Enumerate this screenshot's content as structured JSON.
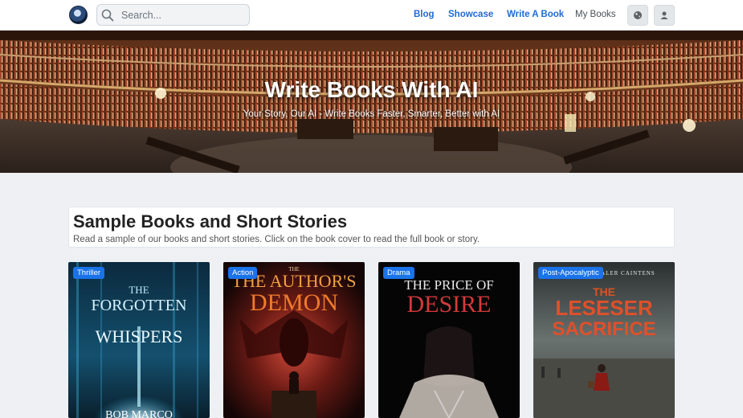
{
  "search": {
    "placeholder": "Search..."
  },
  "nav": {
    "blog": "Blog",
    "showcase": "Showcase",
    "write_a_book": "Write A Book",
    "my_books": "My Books"
  },
  "hero": {
    "title": "Write Books With AI",
    "subtitle": "Your Story, Our AI - Write Books Faster, Smarter, Better with AI"
  },
  "section": {
    "title": "Sample Books and Short Stories",
    "description": "Read a sample of our books and short stories. Click on the book cover to read the full book or story."
  },
  "books": [
    {
      "genre": "Thriller",
      "title_line1": "THE",
      "title_line2": "FORGOTTEN",
      "title_line3": "WHISPERS",
      "author": "BOB MARCO"
    },
    {
      "genre": "Action",
      "title_line1": "THE",
      "title_line2": "THE AUTHOR'S",
      "title_line3": "DEMON"
    },
    {
      "genre": "Drama",
      "title_line1": "THE PRICE OF",
      "title_line2": "DESIRE"
    },
    {
      "genre": "Post-Apocalyptic",
      "author": "TALER CAINTENS",
      "title_line1": "THE",
      "title_line2": "LESESER",
      "title_line3": "SACRIFICE"
    }
  ],
  "colors": {
    "accent": "#1e6bd6",
    "badge": "#1a73e8"
  }
}
